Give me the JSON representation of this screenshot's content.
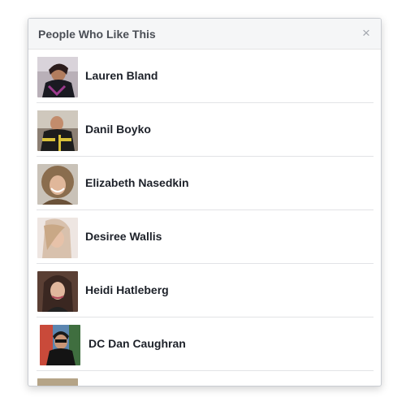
{
  "dialog": {
    "title": "People Who Like This",
    "close_symbol": "×"
  },
  "people": [
    {
      "name": "Lauren Bland"
    },
    {
      "name": "Danil Boyko"
    },
    {
      "name": "Elizabeth Nasedkin"
    },
    {
      "name": "Desiree Wallis"
    },
    {
      "name": "Heidi Hatleberg"
    },
    {
      "name": "DC Dan Caughran"
    }
  ],
  "icons": {
    "close": "close-icon"
  }
}
